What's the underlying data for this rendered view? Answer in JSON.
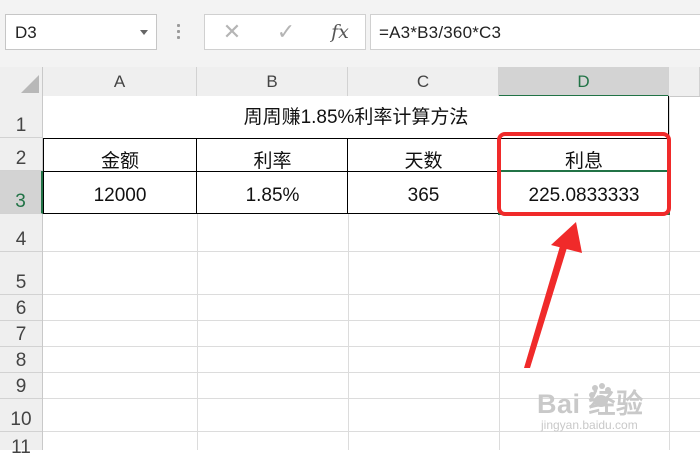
{
  "formula_bar": {
    "name_box": "D3",
    "cancel_icon": "✕",
    "enter_icon": "✓",
    "fx_label": "fx",
    "formula": "=A3*B3/360*C3"
  },
  "columns": [
    "A",
    "B",
    "C",
    "D"
  ],
  "selected_column": "D",
  "rows": [
    "1",
    "2",
    "3",
    "4",
    "5",
    "6",
    "7",
    "8",
    "9",
    "10",
    "11"
  ],
  "selected_row": "3",
  "sheet": {
    "title": "周周赚1.85%利率计算方法",
    "headers": [
      "金额",
      "利率",
      "天数",
      "利息"
    ],
    "values": [
      "12000",
      "1.85%",
      "365",
      "225.0833333"
    ]
  },
  "annotation": {
    "highlight_color": "#f02a2a",
    "target_cell": "D3"
  },
  "watermark": {
    "logo": "Bai  经验",
    "url": "jingyan.baidu.com"
  },
  "colors": {
    "excel_green": "#217346",
    "header_bg": "#efefef",
    "selected_header_bg": "#d3d3d3"
  }
}
